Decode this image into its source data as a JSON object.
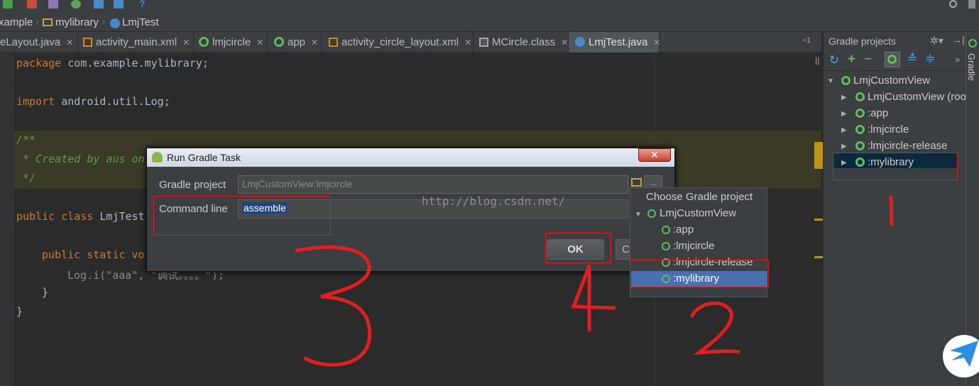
{
  "breadcrumbs": [
    "xample",
    "mylibrary",
    "LmjTest"
  ],
  "tabs": [
    {
      "label": "eLayout.java",
      "close": "✕"
    },
    {
      "label": "activity_main.xml",
      "close": "✕"
    },
    {
      "label": "lmjcircle",
      "close": "✕"
    },
    {
      "label": "app",
      "close": "✕"
    },
    {
      "label": "activity_circle_layout.xml",
      "close": "✕"
    },
    {
      "label": "MCircle.class",
      "close": "✕"
    },
    {
      "label": "LmjTest.java",
      "close": "✕"
    }
  ],
  "tabs_more": "÷1",
  "code": {
    "line1_kw": "package",
    "line1_rest": " com.example.mylibrary;",
    "line2_kw": "import",
    "line2_rest": " android.util.Log;",
    "doc1": "/**",
    "doc2": " * Created by aus on",
    "doc3": " */",
    "class_kw": "public class",
    "class_name": " LmjTest",
    "method_kw": "public static vo",
    "log_line": "Log.i(\"aaa\", \"调试。。。。\");",
    "close1": "}",
    "close2": "}"
  },
  "gradle_panel": {
    "title": "Gradle projects",
    "tree": [
      {
        "label": "LmjCustomView",
        "level": 0,
        "expanded": true
      },
      {
        "label": "LmjCustomView (roo",
        "level": 1
      },
      {
        "label": ":app",
        "level": 1
      },
      {
        "label": ":lmjcircle",
        "level": 1
      },
      {
        "label": ":lmjcircle-release",
        "level": 1
      },
      {
        "label": ":mylibrary",
        "level": 1,
        "selected": true
      }
    ],
    "side_label": "Gradle"
  },
  "dialog": {
    "title": "Run Gradle Task",
    "close": "✕",
    "project_label": "Gradle project",
    "project_value": "LmjCustomView:lmjcircle",
    "command_label": "Command line",
    "command_value": "assemble",
    "ok_label": "OK",
    "cancel_label": "Ca"
  },
  "popup": {
    "title": "Choose Gradle project",
    "root": "LmjCustomView",
    "items": [
      ":app",
      ":lmjcircle",
      ":lmjcircle-release",
      ":mylibrary"
    ],
    "selected": ":mylibrary"
  },
  "watermark": "http://blog.csdn.net/",
  "annotations": [
    "1",
    "2",
    "3",
    "4"
  ],
  "colors": {
    "accent_red": "#e02020",
    "gradle_green": "#5dbc5d",
    "selection": "#4b6eaf"
  }
}
